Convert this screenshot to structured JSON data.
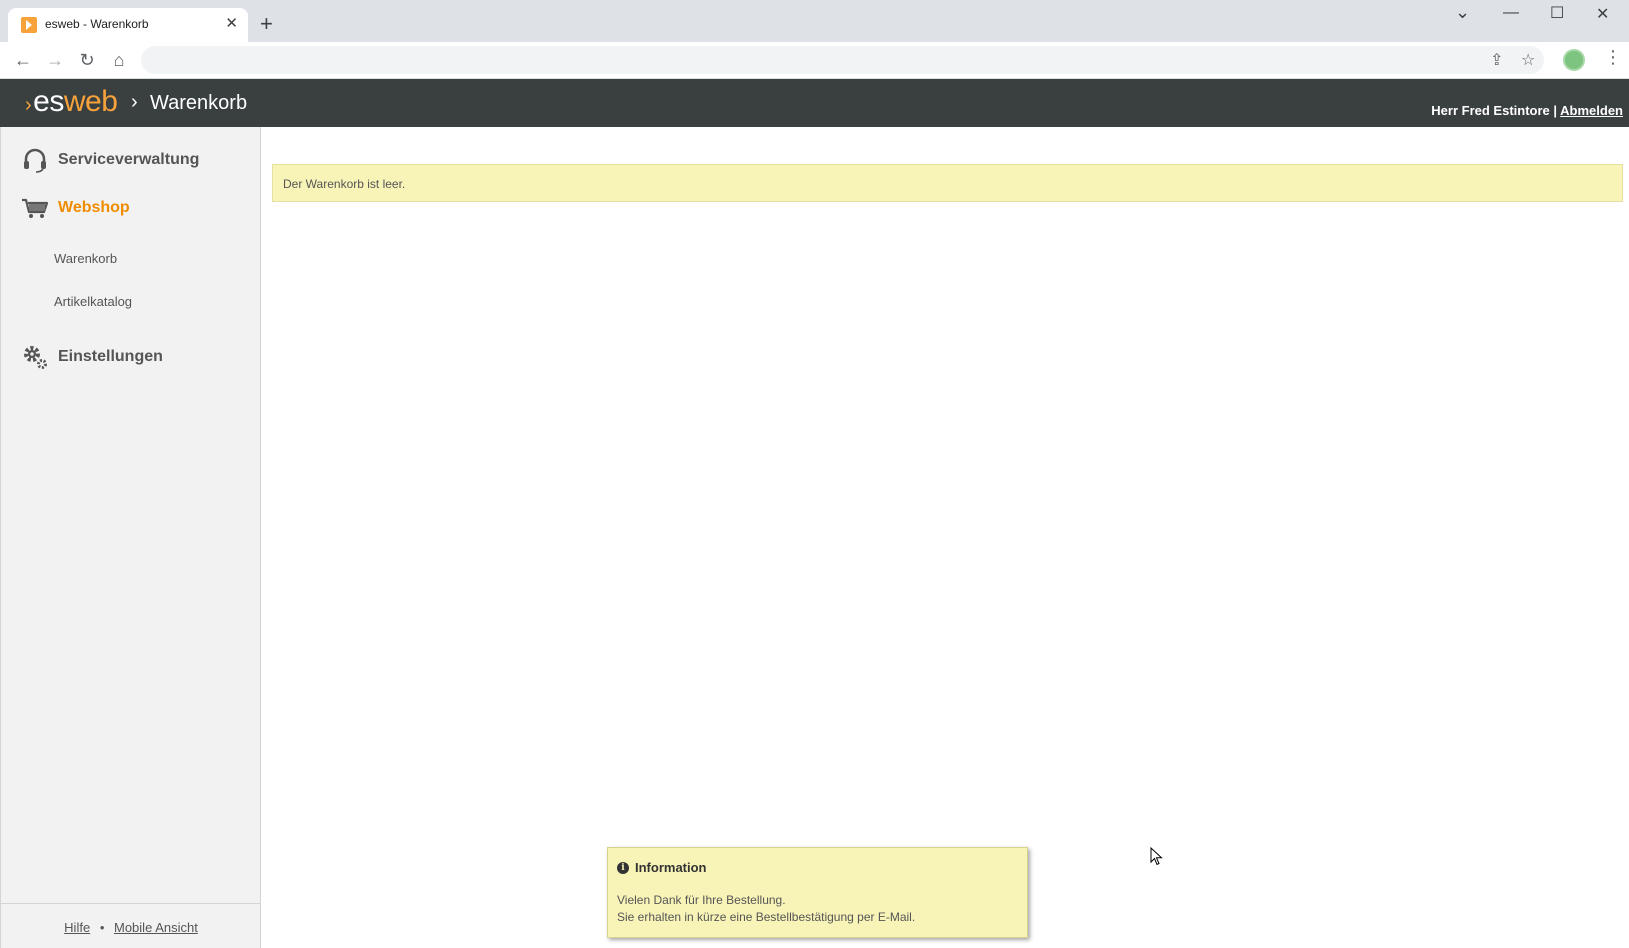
{
  "browser": {
    "tab_title": "esweb - Warenkorb",
    "tab_close": "✕",
    "new_tab": "+",
    "window_controls": [
      "⌄",
      "—",
      "☐",
      "✕"
    ]
  },
  "header": {
    "logo_prefix": "es",
    "logo_suffix": "web",
    "breadcrumb_sep": "›",
    "title": "Warenkorb",
    "user": "Herr Fred Estintore",
    "separator": " | ",
    "logout": "Abmelden"
  },
  "sidebar": {
    "sections": [
      {
        "label": "Serviceverwaltung",
        "icon": "headset-icon"
      },
      {
        "label": "Webshop",
        "icon": "cart-icon",
        "active": true
      },
      {
        "label": "Einstellungen",
        "icon": "gear-icon"
      }
    ],
    "sub_items": [
      "Warenkorb",
      "Artikelkatalog"
    ],
    "footer": {
      "help": "Hilfe",
      "dot": "•",
      "mobile": "Mobile Ansicht"
    }
  },
  "main": {
    "notice": "Der Warenkorb ist leer."
  },
  "toast": {
    "title": "Information",
    "line1": "Vielen Dank für Ihre Bestellung.",
    "line2": "Sie erhalten in kürze eine Bestellbestätigung per E-Mail."
  },
  "colors": {
    "accent": "#f08c00",
    "header_bg": "#3a3f40",
    "notice_bg": "#f8f4b8"
  }
}
